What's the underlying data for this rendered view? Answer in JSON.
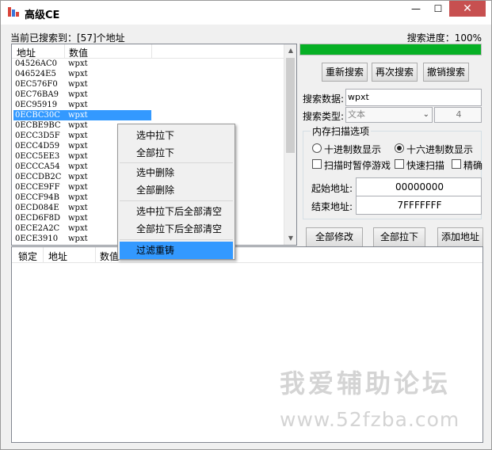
{
  "window": {
    "title": "高级CE",
    "min_glyph": "—",
    "max_glyph": "☐",
    "close_glyph": "✕"
  },
  "status": {
    "found_text": "当前已搜索到：[57]个地址",
    "progress_text": "搜索进度：100%",
    "progress_value": 1.0
  },
  "results_list": {
    "col_address": "地址",
    "col_value": "数值",
    "rows": [
      {
        "address": "04526AC0",
        "value": "wpxt"
      },
      {
        "address": "046524E5",
        "value": "wpxt"
      },
      {
        "address": "0EC576F0",
        "value": "wpxt"
      },
      {
        "address": "0EC76BA9",
        "value": "wpxt"
      },
      {
        "address": "0EC95919",
        "value": "wpxt"
      },
      {
        "address": "0ECBC30C",
        "value": "wpxt"
      },
      {
        "address": "0ECBE9BC",
        "value": "wpxt"
      },
      {
        "address": "0ECC3D5F",
        "value": "wpxt"
      },
      {
        "address": "0ECC4D59",
        "value": "wpxt"
      },
      {
        "address": "0ECC5EE3",
        "value": "wpxt"
      },
      {
        "address": "0ECCCA54",
        "value": "wpxt"
      },
      {
        "address": "0ECCDB2C",
        "value": "wpxt"
      },
      {
        "address": "0ECCE9FF",
        "value": "wpxt"
      },
      {
        "address": "0ECCF94B",
        "value": "wpxt"
      },
      {
        "address": "0ECD084E",
        "value": "wpxt"
      },
      {
        "address": "0ECD6F8D",
        "value": "wpxt"
      },
      {
        "address": "0ECE2A2C",
        "value": "wpxt"
      },
      {
        "address": "0ECE3910",
        "value": "wpxt"
      }
    ],
    "selected_index": 5
  },
  "search_buttons": {
    "research": "重新搜索",
    "search_again": "再次搜索",
    "cancel": "撤销搜索"
  },
  "search_form": {
    "data_label": "搜索数据:",
    "data_value": "wpxt",
    "type_label": "搜索类型:",
    "type_value": "文本",
    "type_length": "4"
  },
  "scan_options": {
    "group_title": "内存扫描选项",
    "hex_decimal": "十进制数显示",
    "hex_hex": "十六进制数显示",
    "pause_game": "扫描时暂停游戏",
    "fast_scan": "快速扫描",
    "exact": "精确",
    "start_label": "起始地址:",
    "start_value": "00000000",
    "end_label": "结束地址:",
    "end_value": "7FFFFFFF"
  },
  "action_buttons": {
    "modify_all": "全部修改",
    "pull_all": "全部拉下",
    "add_address": "添加地址"
  },
  "bottom_list": {
    "col_lock": "锁定",
    "col_address": "地址",
    "col_value": "数值"
  },
  "context_menu": {
    "items": [
      "选中拉下",
      "全部拉下",
      "选中删除",
      "全部删除",
      "选中拉下后全部清空",
      "全部拉下后全部清空",
      "过滤重铸"
    ],
    "active_index": 6
  },
  "watermark": {
    "line1": "我爱辅助论坛",
    "line2": "www.52fzba.com"
  },
  "colors": {
    "progress_fill": "#06b025",
    "selection": "#3399ff",
    "close_button": "#c75050"
  }
}
